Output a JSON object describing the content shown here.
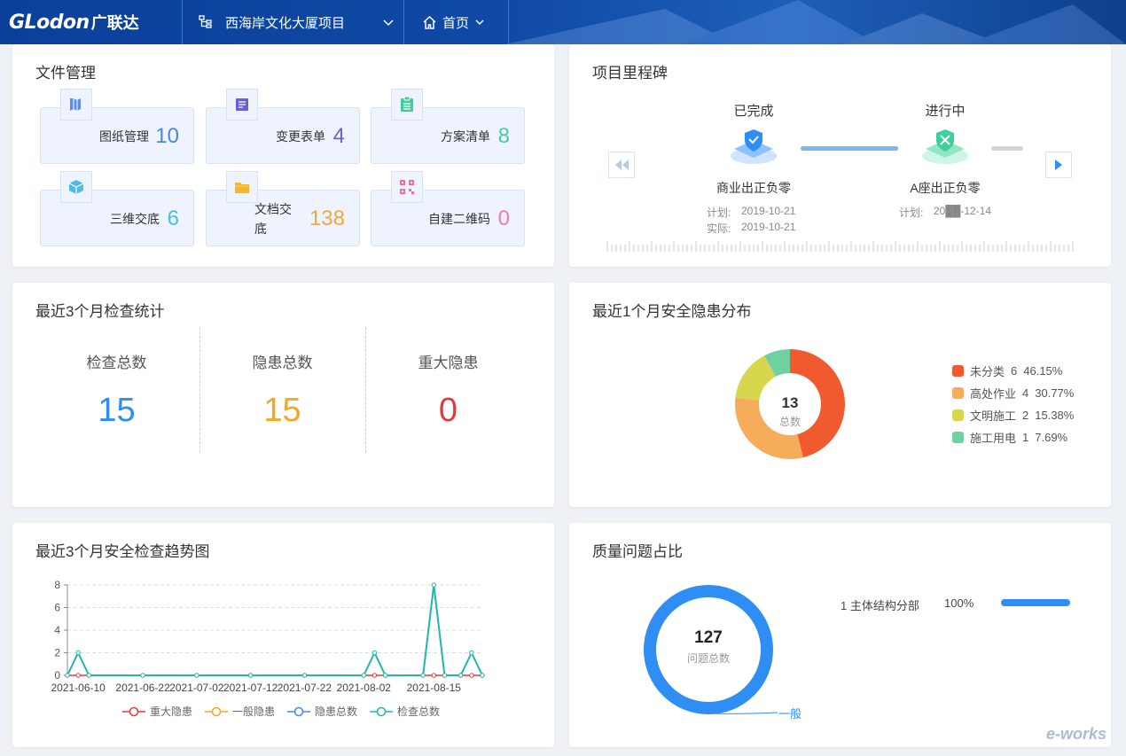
{
  "header": {
    "logo_en": "GLodon",
    "logo_cn": "广联达",
    "project_name": "西海岸文化大厦项目",
    "home_label": "首页"
  },
  "file_management": {
    "title": "文件管理",
    "tiles": [
      {
        "label": "图纸管理",
        "count": "10",
        "color": "#4a87e8",
        "icon": "blueprint-icon",
        "icon_color": "#5b8def"
      },
      {
        "label": "变更表单",
        "count": "4",
        "color": "#6b5fd6",
        "icon": "form-icon",
        "icon_color": "#6b5fd6"
      },
      {
        "label": "方案清单",
        "count": "8",
        "color": "#3fcf9c",
        "icon": "checklist-icon",
        "icon_color": "#3fcf9c"
      },
      {
        "label": "三维交底",
        "count": "6",
        "color": "#4dbde8",
        "icon": "cube-icon",
        "icon_color": "#4dbde8"
      },
      {
        "label": "文档交底",
        "label_line1": "文档交",
        "label_line2": "底",
        "count": "138",
        "color": "#f2a73b",
        "icon": "folder-icon",
        "icon_color": "#f5b62e"
      },
      {
        "label": "自建二维码",
        "count": "0",
        "color": "#ee7cae",
        "icon": "qrcode-icon",
        "icon_color": "#ee6fa6"
      }
    ]
  },
  "milestones": {
    "title": "项目里程碑",
    "items": [
      {
        "status": "已完成",
        "name": "商业出正负零",
        "plan_label": "计划:",
        "plan_date": "2019-10-21",
        "actual_label": "实际:",
        "actual_date": "2019-10-21",
        "color": "#2e8ef3"
      },
      {
        "status": "进行中",
        "name": "A座出正负零",
        "plan_label": "计划:",
        "plan_date": "20██-12-14",
        "color": "#3fcf9c"
      }
    ]
  },
  "inspection_stats": {
    "title": "最近3个月检查统计",
    "items": [
      {
        "label": "检查总数",
        "value": "15",
        "color": "#2e8ef3"
      },
      {
        "label": "隐患总数",
        "value": "15",
        "color": "#f5a623"
      },
      {
        "label": "重大隐患",
        "value": "0",
        "color": "#e6393d"
      }
    ]
  },
  "hazard_distribution": {
    "title": "最近1个月安全隐患分布",
    "total": "13",
    "total_label": "总数",
    "items": [
      {
        "name": "未分类",
        "count": "6",
        "percent": "46.15%",
        "value": 6,
        "color": "#f05a2e"
      },
      {
        "name": "高处作业",
        "count": "4",
        "percent": "30.77%",
        "value": 4,
        "color": "#f5ac5b"
      },
      {
        "name": "文明施工",
        "count": "2",
        "percent": "15.38%",
        "value": 2,
        "color": "#d7d64c"
      },
      {
        "name": "施工用电",
        "count": "1",
        "percent": "7.69%",
        "value": 1,
        "color": "#6fd0a0"
      }
    ]
  },
  "trend_chart": {
    "title": "最近3个月安全检查趋势图"
  },
  "chart_data": {
    "type": "line",
    "x": [
      "2021-06-08",
      "2021-06-10",
      "2021-06-12",
      "2021-06-22",
      "2021-07-02",
      "2021-07-12",
      "2021-07-22",
      "2021-08-02",
      "2021-08-04",
      "2021-08-06",
      "2021-08-13",
      "2021-08-15",
      "2021-08-17",
      "2021-08-20",
      "2021-08-22",
      "2021-08-24"
    ],
    "xticks": [
      "2021-06-10",
      "2021-06-22",
      "2021-07-02",
      "2021-07-12",
      "2021-07-22",
      "2021-08-02",
      "2021-08-15"
    ],
    "ylim": [
      0,
      8
    ],
    "yticks": [
      0,
      2,
      4,
      6,
      8
    ],
    "series": [
      {
        "name": "重大隐患",
        "color": "#e6393d",
        "values": [
          0,
          0,
          0,
          0,
          0,
          0,
          0,
          0,
          0,
          0,
          0,
          0,
          0,
          0,
          0,
          0
        ]
      },
      {
        "name": "一般隐患",
        "color": "#f5a623",
        "values": [
          0,
          2,
          0,
          0,
          0,
          0,
          0,
          0,
          2,
          0,
          0,
          8,
          0,
          0,
          2,
          0
        ]
      },
      {
        "name": "隐患总数",
        "color": "#4a87e8",
        "values": [
          0,
          2,
          0,
          0,
          0,
          0,
          0,
          0,
          2,
          0,
          0,
          8,
          0,
          0,
          2,
          0
        ]
      },
      {
        "name": "检查总数",
        "color": "#22b8a8",
        "values": [
          0,
          2,
          0,
          0,
          0,
          0,
          0,
          0,
          2,
          0,
          0,
          8,
          0,
          0,
          2,
          0
        ]
      }
    ],
    "grid": true,
    "legend": "bottom"
  },
  "quality": {
    "title": "质量问题占比",
    "total": "127",
    "total_label": "问题总数",
    "ring_label": "一般",
    "rows": [
      {
        "name": "1 主体结构分部",
        "percent": "100%",
        "fraction": 1.0
      }
    ],
    "color": "#2e8ef3"
  },
  "watermark": "e-works"
}
